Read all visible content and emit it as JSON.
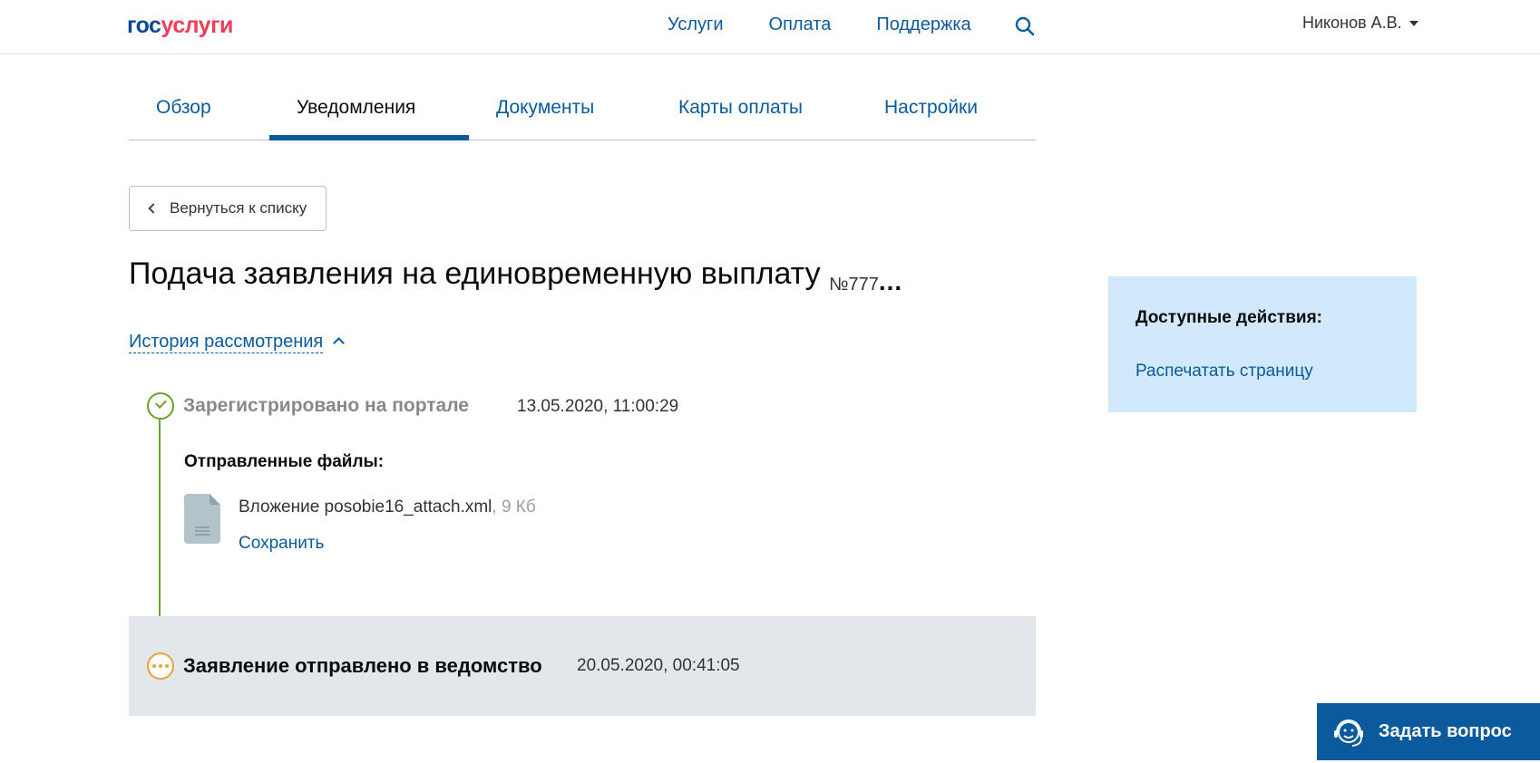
{
  "header": {
    "logo_gos": "гос",
    "logo_uslugi": "услуги",
    "nav": [
      "Услуги",
      "Оплата",
      "Поддержка"
    ],
    "user_name": "Никонов А.В."
  },
  "tabs": [
    "Обзор",
    "Уведомления",
    "Документы",
    "Карты оплаты",
    "Настройки"
  ],
  "active_tab": "Уведомления",
  "back_button_label": "Вернуться к списку",
  "page_title": "Подача заявления на единовременную выплату",
  "request_number": "№777",
  "request_number_more": "...",
  "history_link": "История рассмотрения",
  "timeline": {
    "step1": {
      "title": "Зарегистрировано на портале",
      "time": "13.05.2020, 11:00:29",
      "status": "done"
    },
    "files_label": "Отправленные файлы:",
    "file": {
      "name": "Вложение posobie16_attach.xml",
      "size": ", 9 Кб",
      "save_label": "Сохранить"
    },
    "step2": {
      "title": "Заявление отправлено в ведомство",
      "time": "20.05.2020, 00:41:05",
      "status": "pending"
    }
  },
  "side_panel": {
    "title": "Доступные действия:",
    "print_link": "Распечатать страницу"
  },
  "ask_button_label": "Задать вопрос",
  "colors": {
    "brand_blue": "#0b5a9d",
    "logo_red": "#ee3f58",
    "status_done": "#6ba32a",
    "status_pending": "#e9a23b",
    "side_panel_bg": "#d0e9fc"
  }
}
